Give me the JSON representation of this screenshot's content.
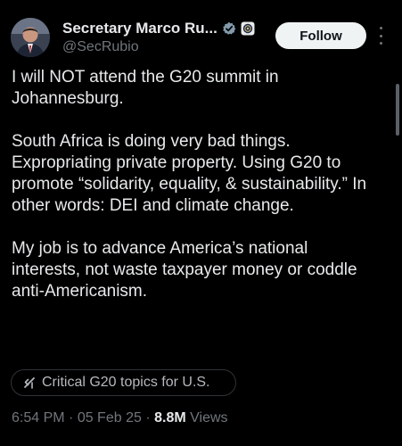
{
  "author": {
    "display_name": "Secretary Marco Ru...",
    "handle": "@SecRubio",
    "verified_badge": "verified-badge-icon",
    "affiliate_badge": "government-seal-icon"
  },
  "follow_button": {
    "label": "Follow"
  },
  "more_menu": {
    "icon": "more-options-icon"
  },
  "post": {
    "paragraphs": [
      "I will NOT attend the G20 summit in Johannesburg.",
      "South Africa is doing very bad things. Expropriating private property. Using G20 to promote “solidarity, equality, & sustainability.” In other words: DEI and climate change.",
      "My job is to advance America’s national interests, not waste taxpayer money or coddle anti-Americanism."
    ]
  },
  "topic_chip": {
    "icon": "grok-icon",
    "label": "Critical G20 topics for U.S."
  },
  "meta": {
    "time": "6:54 PM",
    "separator": " · ",
    "date": "05 Feb 25",
    "views_count": "8.8M",
    "views_label": "Views"
  },
  "colors": {
    "background": "#000000",
    "text_primary": "#e7e9ea",
    "text_secondary": "#71767b",
    "follow_bg": "#eff3f4",
    "verified_gray": "#829aab"
  }
}
